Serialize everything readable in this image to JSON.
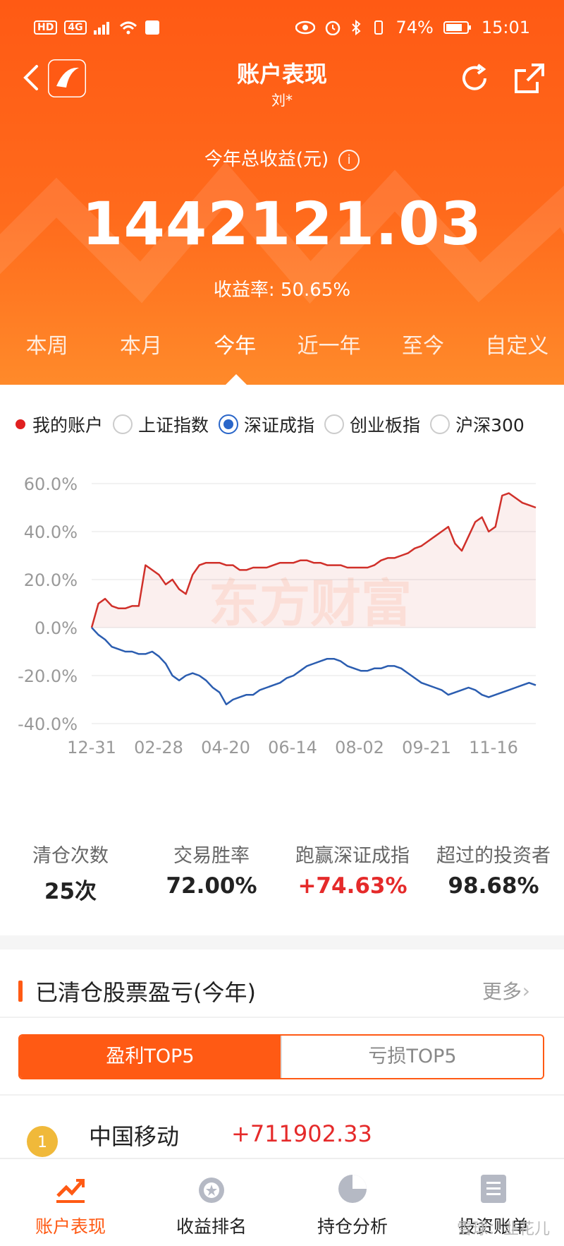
{
  "status_bar": {
    "left_icons": [
      "HD",
      "4G",
      "signal-icon",
      "wifi-icon",
      "sim-icon"
    ],
    "battery": "74%",
    "time": "15:01"
  },
  "nav": {
    "title": "账户表现",
    "subtitle": "刘*"
  },
  "summary": {
    "total_label": "今年总收益(元)",
    "total_value": "1442121.03",
    "rate_label": "收益率:",
    "rate_value": "50.65%"
  },
  "period_tabs": [
    "本周",
    "本月",
    "今年",
    "近一年",
    "至今",
    "自定义"
  ],
  "active_period_index": 2,
  "legend": {
    "my_account": "我的账户",
    "indices": [
      "上证指数",
      "深证成指",
      "创业板指",
      "沪深300"
    ],
    "selected_index": 1
  },
  "chart_data": {
    "type": "line",
    "x": [
      "12-31",
      "02-28",
      "04-20",
      "06-14",
      "08-02",
      "09-21",
      "11-16"
    ],
    "ylim": [
      -40,
      60
    ],
    "yticks": [
      "60.0%",
      "40.0%",
      "20.0%",
      "0.0%",
      "-20.0%",
      "-40.0%"
    ],
    "watermark": "东方财富",
    "series": [
      {
        "name": "我的账户",
        "color": "#d0302a",
        "values": [
          0,
          10,
          12,
          9,
          8,
          8,
          9,
          9,
          26,
          24,
          22,
          18,
          20,
          16,
          14,
          22,
          26,
          27,
          27,
          27,
          26,
          26,
          24,
          24,
          25,
          25,
          25,
          26,
          27,
          27,
          27,
          28,
          28,
          27,
          27,
          26,
          26,
          26,
          25,
          25,
          25,
          25,
          26,
          28,
          29,
          29,
          30,
          31,
          33,
          34,
          36,
          38,
          40,
          42,
          35,
          32,
          38,
          44,
          46,
          40,
          42,
          55,
          56,
          54,
          52,
          51,
          50
        ]
      },
      {
        "name": "深证成指",
        "color": "#2b5db0",
        "values": [
          0,
          -3,
          -5,
          -8,
          -9,
          -10,
          -10,
          -11,
          -11,
          -10,
          -12,
          -15,
          -20,
          -22,
          -20,
          -19,
          -20,
          -22,
          -25,
          -27,
          -32,
          -30,
          -29,
          -28,
          -28,
          -26,
          -25,
          -24,
          -23,
          -21,
          -20,
          -18,
          -16,
          -15,
          -14,
          -13,
          -13,
          -14,
          -16,
          -17,
          -18,
          -18,
          -17,
          -17,
          -16,
          -16,
          -17,
          -19,
          -21,
          -23,
          -24,
          -25,
          -26,
          -28,
          -27,
          -26,
          -25,
          -26,
          -28,
          -29,
          -28,
          -27,
          -26,
          -25,
          -24,
          -23,
          -24
        ]
      }
    ]
  },
  "stats": [
    {
      "label": "清仓次数",
      "value": "25次",
      "red": false
    },
    {
      "label": "交易胜率",
      "value": "72.00%",
      "red": false
    },
    {
      "label": "跑赢深证成指",
      "value": "+74.63%",
      "red": true
    },
    {
      "label": "超过的投资者",
      "value": "98.68%",
      "red": false
    }
  ],
  "section": {
    "title": "已清仓股票盈亏(今年)",
    "more": "更多",
    "tab_profit": "盈利TOP5",
    "tab_loss": "亏损TOP5",
    "rows": [
      {
        "rank": "1",
        "name": "中国移动",
        "pl": "+711902.33"
      }
    ]
  },
  "bottom_nav": [
    {
      "label": "账户表现",
      "icon": "chart-up-icon"
    },
    {
      "label": "收益排名",
      "icon": "medal-icon"
    },
    {
      "label": "持仓分析",
      "icon": "pie-chart-icon"
    },
    {
      "label": "投资账单",
      "icon": "document-icon"
    }
  ],
  "watermark": "雪球：韭花儿",
  "colors": {
    "accent": "#ff5a14",
    "red": "#e52a2a",
    "blue": "#2b5db0"
  }
}
